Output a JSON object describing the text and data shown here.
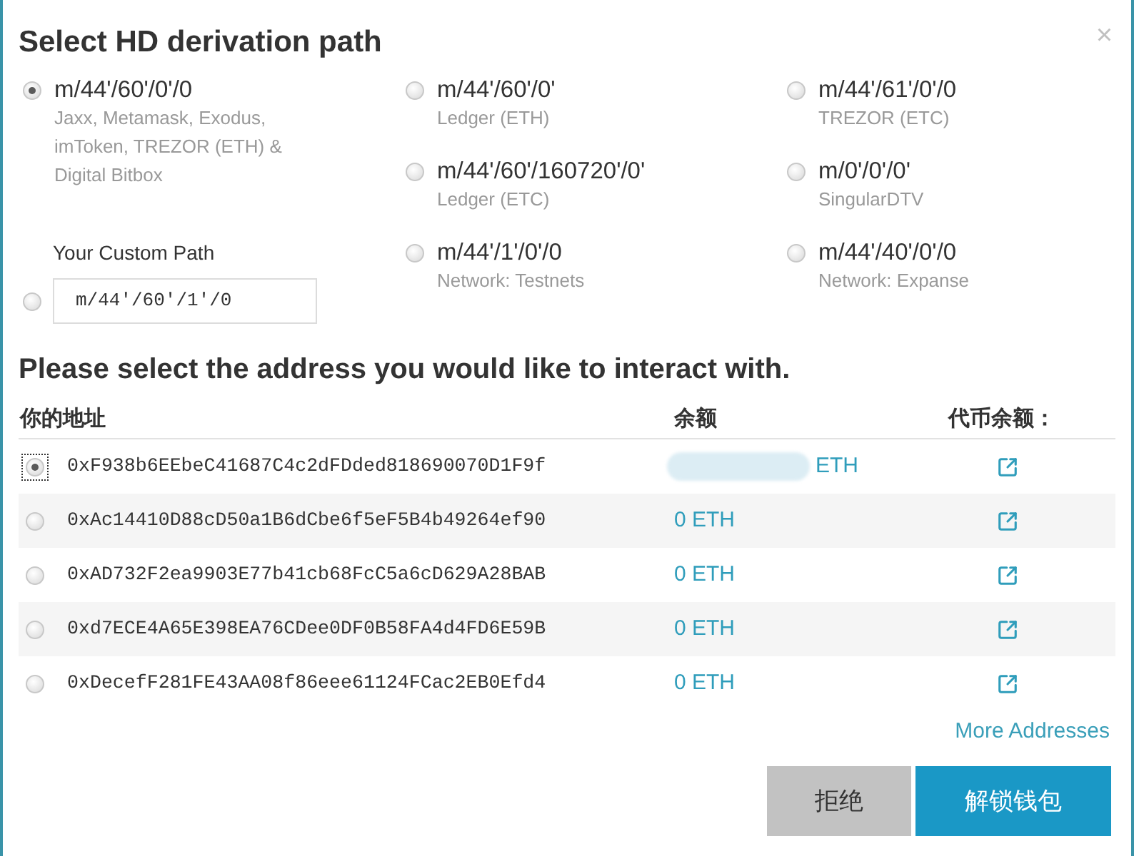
{
  "dialog": {
    "title": "Select HD derivation path",
    "close_label": "×"
  },
  "path_columns": [
    {
      "options": [
        {
          "kind": "preset",
          "path": "m/44'/60'/0'/0",
          "description": "Jaxx, Metamask, Exodus, imToken, TREZOR (ETH) & Digital Bitbox",
          "selected": true
        },
        {
          "kind": "custom",
          "label": "Your Custom Path",
          "value": "m/44'/60'/1'/0",
          "selected": false
        }
      ]
    },
    {
      "options": [
        {
          "kind": "preset",
          "path": "m/44'/60'/0'",
          "description": "Ledger (ETH)",
          "selected": false
        },
        {
          "kind": "preset",
          "path": "m/44'/60'/160720'/0'",
          "description": "Ledger (ETC)",
          "selected": false
        },
        {
          "kind": "preset",
          "path": "m/44'/1'/0'/0",
          "description": "Network: Testnets",
          "selected": false
        }
      ]
    },
    {
      "options": [
        {
          "kind": "preset",
          "path": "m/44'/61'/0'/0",
          "description": "TREZOR (ETC)",
          "selected": false
        },
        {
          "kind": "preset",
          "path": "m/0'/0'/0'",
          "description": "SingularDTV",
          "selected": false
        },
        {
          "kind": "preset",
          "path": "m/44'/40'/0'/0",
          "description": "Network: Expanse",
          "selected": false
        }
      ]
    }
  ],
  "address_section": {
    "heading": "Please select the address you would like to interact with.",
    "columns": [
      "你的地址",
      "余额",
      "代币余额："
    ],
    "rows": [
      {
        "address": "0xF938b6EEbeC41687C4c2dFDded818690070D1F9f",
        "balance": "ETH",
        "redacted": true,
        "selected": true
      },
      {
        "address": "0xAc14410D88cD50a1B6dCbe6f5eF5B4b49264ef90",
        "balance": "0 ETH",
        "redacted": false,
        "selected": false
      },
      {
        "address": "0xAD732F2ea9903E77b41cb68FcC5a6cD629A28BAB",
        "balance": "0 ETH",
        "redacted": false,
        "selected": false
      },
      {
        "address": "0xd7ECE4A65E398EA76CDee0DF0B58FA4d4FD6E59B",
        "balance": "0 ETH",
        "redacted": false,
        "selected": false
      },
      {
        "address": "0xDecefF281FE43AA08f86eee61124FCac2EB0Efd4",
        "balance": "0 ETH",
        "redacted": false,
        "selected": false
      }
    ],
    "more_link": "More Addresses"
  },
  "buttons": [
    {
      "kind": "secondary",
      "label": "拒绝"
    },
    {
      "kind": "primary",
      "label": "解锁钱包"
    }
  ]
}
